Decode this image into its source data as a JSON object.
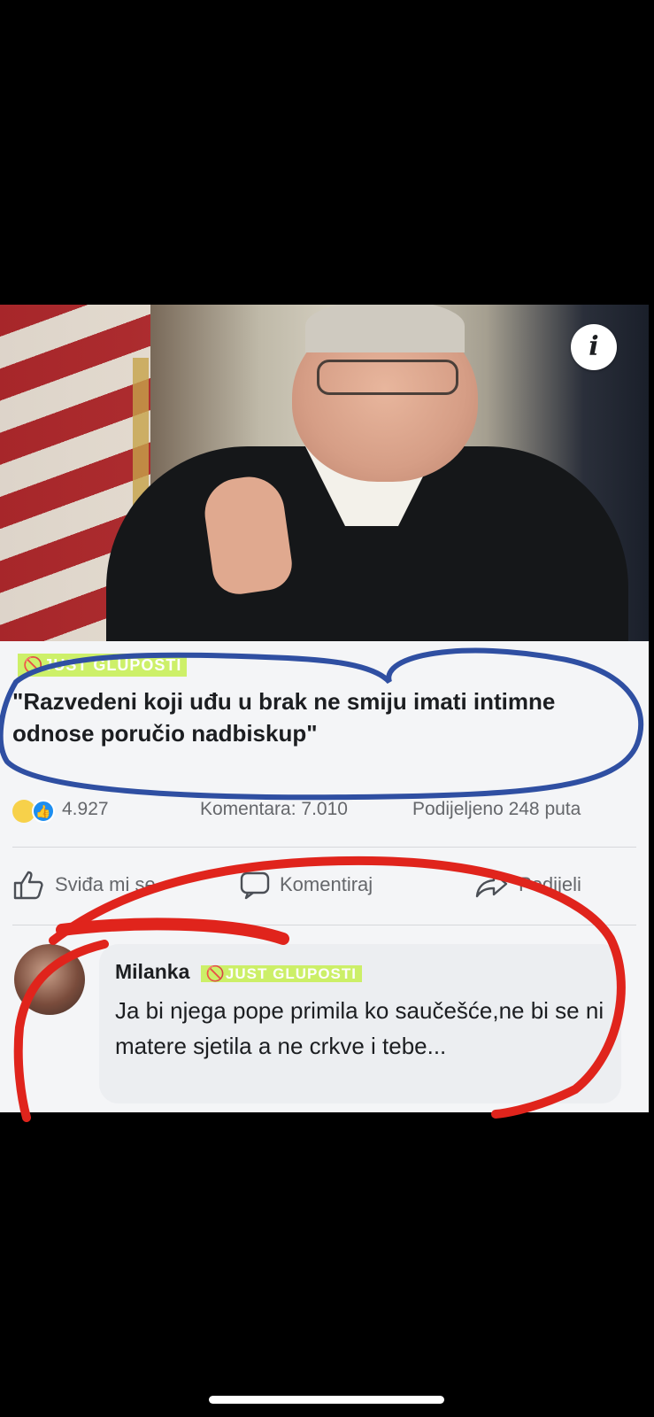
{
  "post": {
    "badge": "🚫JUST GLUPOSTI",
    "headline": "\"Razvedeni koji uđu u brak ne smiju imati intimne odnose poručio nadbiskup\"",
    "info_icon": "info-icon",
    "info_glyph": "i"
  },
  "stats": {
    "reaction_icons": [
      "haha-reaction-icon",
      "like-reaction-icon"
    ],
    "reactions": "4.927",
    "comments": "Komentara: 7.010",
    "shares": "Podijeljeno 248 puta"
  },
  "actions": {
    "like": "Sviđa mi se",
    "comment": "Komentiraj",
    "share": "Podijeli"
  },
  "comment": {
    "author": "Milanka",
    "badge": "🚫JUST GLUPOSTI",
    "text": "Ja bi njega pope primila ko saučešće,ne bi se ni matere sjetila a ne crkve i tebe..."
  },
  "colors": {
    "badge": "#c9f05a",
    "blue_annotation": "#2f4fa2",
    "red_annotation": "#e0241c",
    "like_blue": "#1d8ef0"
  }
}
